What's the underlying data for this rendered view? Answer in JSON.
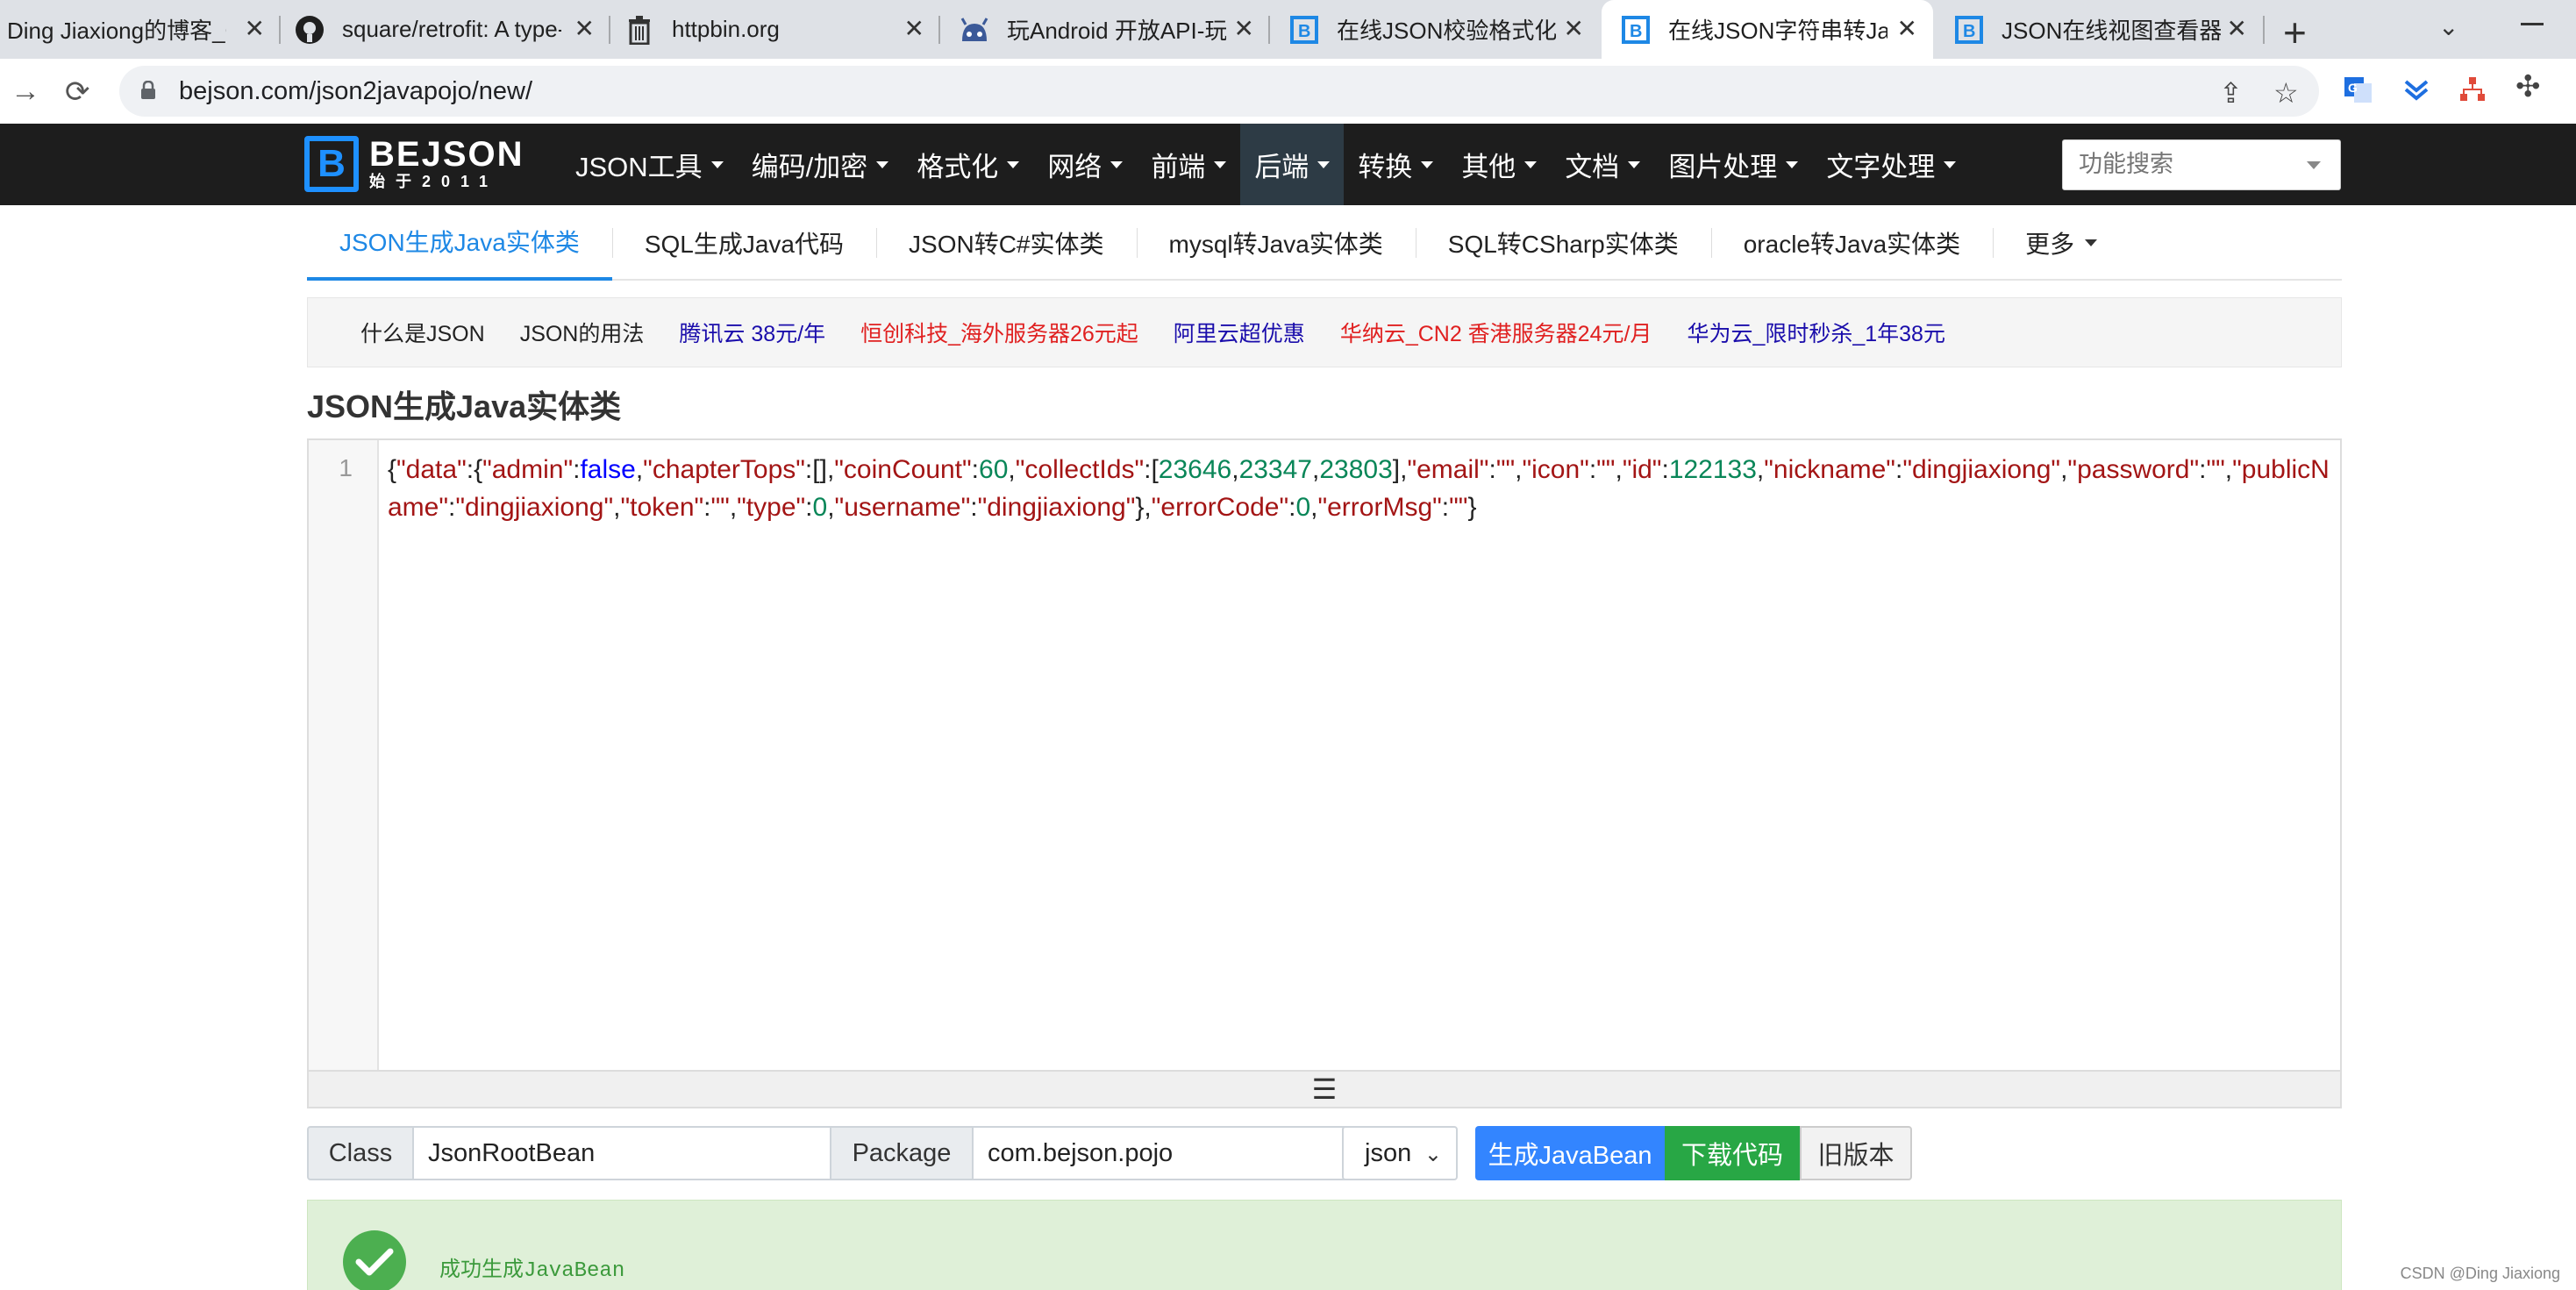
{
  "browser": {
    "tabs": [
      {
        "title": "Ding Jiaxiong的博客_CSDN博客",
        "icon": "csdn-icon"
      },
      {
        "title": "square/retrofit: A type-safe",
        "icon": "github-icon"
      },
      {
        "title": "httpbin.org",
        "icon": "trash-icon"
      },
      {
        "title": "玩Android 开放API-玩Android",
        "icon": "android-icon"
      },
      {
        "title": "在线JSON校验格式化工具",
        "icon": "bejson-icon"
      },
      {
        "title": "在线JSON字符串转Java实体类",
        "icon": "bejson-icon"
      },
      {
        "title": "JSON在线视图查看器(Online",
        "icon": "bejson-icon"
      }
    ],
    "active_tab": 5,
    "url": "bejson.com/json2javapojo/new/"
  },
  "site": {
    "logo_big": "BEJSON",
    "logo_small": "始于2011",
    "menu": [
      {
        "label": "JSON工具"
      },
      {
        "label": "编码/加密"
      },
      {
        "label": "格式化"
      },
      {
        "label": "网络"
      },
      {
        "label": "前端"
      },
      {
        "label": "后端"
      },
      {
        "label": "转换"
      },
      {
        "label": "其他"
      },
      {
        "label": "文档"
      },
      {
        "label": "图片处理"
      },
      {
        "label": "文字处理"
      }
    ],
    "active_menu": 5,
    "search_placeholder": "功能搜索"
  },
  "subtabs": [
    {
      "label": "JSON生成Java实体类"
    },
    {
      "label": "SQL生成Java代码"
    },
    {
      "label": "JSON转C#实体类"
    },
    {
      "label": "mysql转Java实体类"
    },
    {
      "label": "SQL转CSharp实体类"
    },
    {
      "label": "oracle转Java实体类"
    },
    {
      "label": "更多"
    }
  ],
  "links": [
    {
      "label": "什么是JSON",
      "color": "#222222"
    },
    {
      "label": "JSON的用法",
      "color": "#222222"
    },
    {
      "label": "腾讯云 38元/年",
      "color": "#1a0dab"
    },
    {
      "label": "恒创科技_海外服务器26元起",
      "color": "#e02020"
    },
    {
      "label": "阿里云超优惠",
      "color": "#1a0dab"
    },
    {
      "label": "华纳云_CN2 香港服务器24元/月",
      "color": "#e02020"
    },
    {
      "label": "华为云_限时秒杀_1年38元",
      "color": "#1a0dab"
    }
  ],
  "heading": "JSON生成Java实体类",
  "editor": {
    "line_number": "1",
    "json_text": "{\"data\":{\"admin\":false,\"chapterTops\":[],\"coinCount\":60,\"collectIds\":[23646,23347,23803],\"email\":\"\",\"icon\":\"\",\"id\":122133,\"nickname\":\"dingjiaxiong\",\"password\":\"\",\"publicName\":\"dingjiaxiong\",\"token\":\"\",\"type\":0,\"username\":\"dingjiaxiong\"},\"errorCode\":0,\"errorMsg\":\"\"}"
  },
  "form": {
    "class_label": "Class",
    "class_value": "JsonRootBean",
    "package_label": "Package",
    "package_value": "com.bejson.pojo",
    "format_selected": "json",
    "generate_label": "生成JavaBean",
    "download_label": "下载代码",
    "old_version_label": "旧版本"
  },
  "alert": {
    "message": "成功生成JavaBean"
  },
  "watermark": "CSDN @Ding Jiaxiong",
  "colors": {
    "nav_bg": "#1d1d1d",
    "accent": "#1e88e5",
    "primary": "#3385ff",
    "success": "#28a745"
  }
}
